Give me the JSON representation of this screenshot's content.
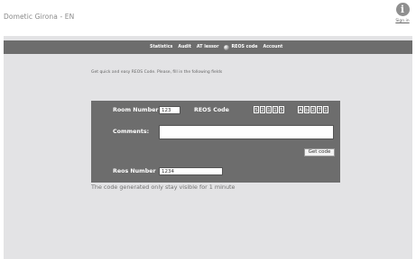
{
  "header": {
    "title": "Dometic Girona - EN",
    "signin_icon": "i",
    "signin_label": "Sign in"
  },
  "nav": {
    "items": [
      "Statistics",
      "Audit",
      "AT lessor",
      "REOS code",
      "Account"
    ]
  },
  "form": {
    "intro": "Get quick and easy REOS Code. Please, fill in the following fields",
    "room_label": "Room Number",
    "room_value": "123",
    "reos_code_label": "REOS Code",
    "code_group_1": [
      "5",
      "2",
      "1",
      "1",
      "5"
    ],
    "code_group_2": [
      "A",
      "b",
      "2",
      "7",
      "1"
    ],
    "comments_label": "Comments:",
    "comments_value": "",
    "get_code_label": "Get code",
    "reos_number_label": "Reos Number",
    "reos_number_value": "1234",
    "note": "The code generated only stay visible for 1 minute"
  },
  "colors": {
    "nav_bg": "#6d6d6d",
    "content_bg": "#e3e3e5",
    "title_color": "#8a8a8a"
  }
}
